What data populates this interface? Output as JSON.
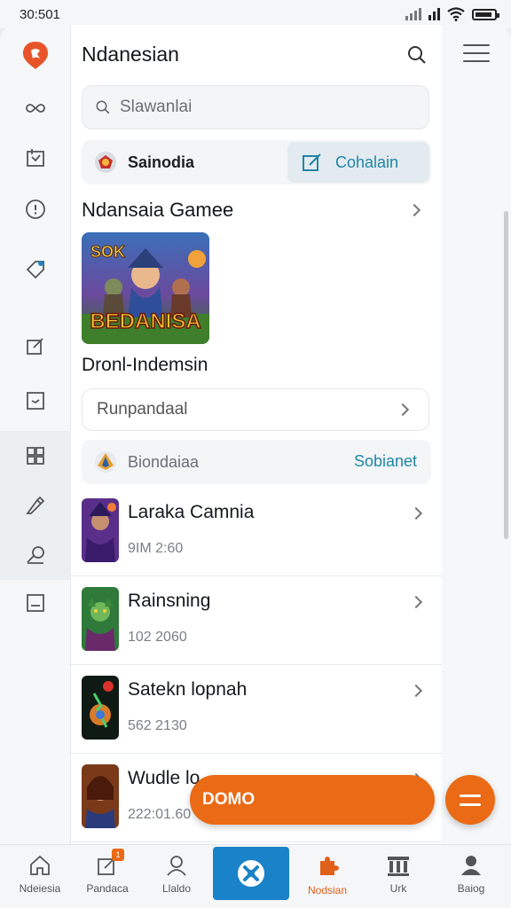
{
  "status_bar": {
    "time": "30:501"
  },
  "header": {
    "title": "Ndanesian"
  },
  "search": {
    "placeholder": "Slawanlai"
  },
  "category_row": {
    "chip_label": "Sainodia",
    "action_label": "Cohalain"
  },
  "section": {
    "title": "Ndansaia Gamee"
  },
  "featured": {
    "caption": "Dronl-Indemsin",
    "art_text_top": "SOK",
    "art_text_main": "BEDANISA"
  },
  "select": {
    "value": "Runpandaal"
  },
  "band": {
    "label": "Biondaiaa",
    "action_label": "Sobianet"
  },
  "list_items": [
    {
      "title": "Laraka Camnia",
      "meta": "9IM 2:60"
    },
    {
      "title": "Rainsning",
      "meta": "102 2060"
    },
    {
      "title": "Satekn lopnah",
      "meta": "562 2130"
    },
    {
      "title": "Wudle lo",
      "meta": "222:01.60"
    }
  ],
  "cta": {
    "label": "DOMO"
  },
  "bottom_nav": [
    {
      "label": "Ndeiesia",
      "icon": "home-icon"
    },
    {
      "label": "Pandaca",
      "icon": "edit-icon",
      "badge": "1"
    },
    {
      "label": "Llaldo",
      "icon": "person-icon"
    },
    {
      "label": "",
      "icon": "controller-icon"
    },
    {
      "label": "Nodsian",
      "icon": "puzzle-icon"
    },
    {
      "label": "Urk",
      "icon": "bank-icon"
    },
    {
      "label": "Baiog",
      "icon": "profile-icon"
    }
  ],
  "colors": {
    "accent": "#ea6a15",
    "link": "#1f86a6",
    "nav_center": "#1a82c8",
    "brand": "#e8542a"
  }
}
